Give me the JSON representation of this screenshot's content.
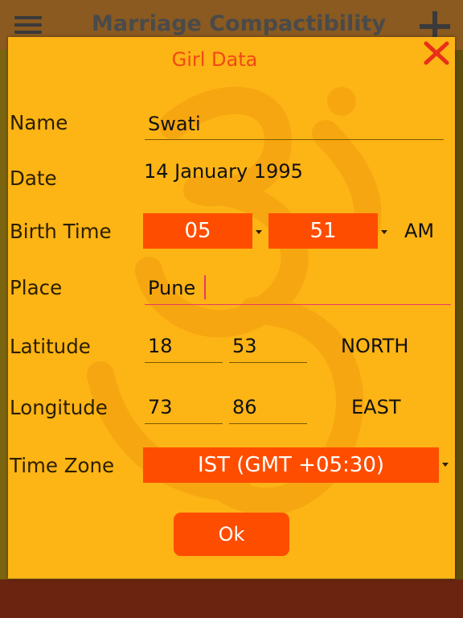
{
  "app_bar": {
    "title": "Marriage Compactibility",
    "menu_icon": "hamburger-menu-icon",
    "add_icon": "plus-icon"
  },
  "dialog": {
    "title": "Girl Data",
    "close_icon": "close-x-icon",
    "name": {
      "label": "Name",
      "value": "Swati"
    },
    "date": {
      "label": "Date",
      "value": "14 January 1995"
    },
    "birth_time": {
      "label": "Birth Time",
      "hour": "05",
      "minute": "51",
      "meridiem": "AM"
    },
    "place": {
      "label": "Place",
      "value": "Pune"
    },
    "latitude": {
      "label": "Latitude",
      "degrees": "18",
      "minutes": "53",
      "direction": "NORTH"
    },
    "longitude": {
      "label": "Longitude",
      "degrees": "73",
      "minutes": "86",
      "direction": "EAST"
    },
    "time_zone": {
      "label": "Time Zone",
      "value": "IST (GMT +05:30)"
    },
    "ok_label": "Ok"
  },
  "colors": {
    "dialog_bg": "#fdb415",
    "accent": "#ff4d00",
    "title": "#f04a14",
    "close": "#e8301a",
    "focus_underline": "#e8396a"
  }
}
